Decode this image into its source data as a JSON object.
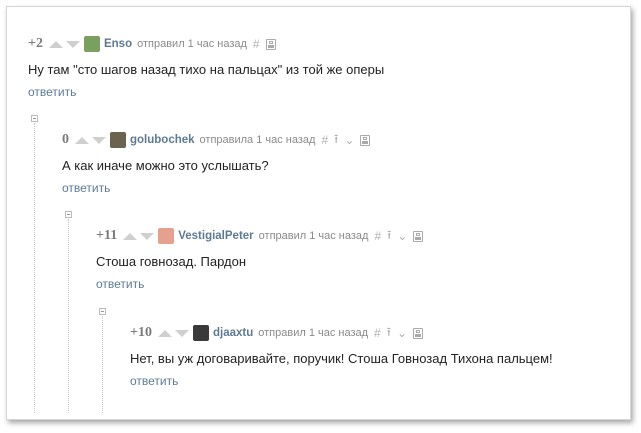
{
  "comments": [
    {
      "rating": "+2",
      "author": "Enso",
      "meta": "отправил 1 час назад",
      "avatar_color": "#7aa060",
      "text": "Ну там \"сто шагов назад тихо на пальцах\" из той же оперы",
      "reply_label": "ответить"
    },
    {
      "rating": "0",
      "author": "golubochek",
      "meta": "отправила 1 час назад",
      "avatar_color": "#6b6250",
      "text": "А как иначе можно это услышать?",
      "reply_label": "ответить"
    },
    {
      "rating": "+11",
      "author": "VestigialPeter",
      "meta": "отправил 1 час назад",
      "avatar_color": "#e8a08e",
      "text": "Стоша говнозад. Пардон",
      "reply_label": "ответить"
    },
    {
      "rating": "+10",
      "author": "djaaxtu",
      "meta": "отправил 1 час назад",
      "avatar_color": "#3a3a3a",
      "text": "Нет, вы уж договаривайте, поручик! Стоша Говнозад Тихона пальцем!",
      "reply_label": "ответить"
    }
  ],
  "icons": {
    "hash": "#",
    "up_arrow": "⭱",
    "branch": "⌄"
  },
  "colors": {
    "link": "#5d7a95",
    "rating": "#7a7a7a",
    "vote_arrow": "#cfcfcf"
  }
}
